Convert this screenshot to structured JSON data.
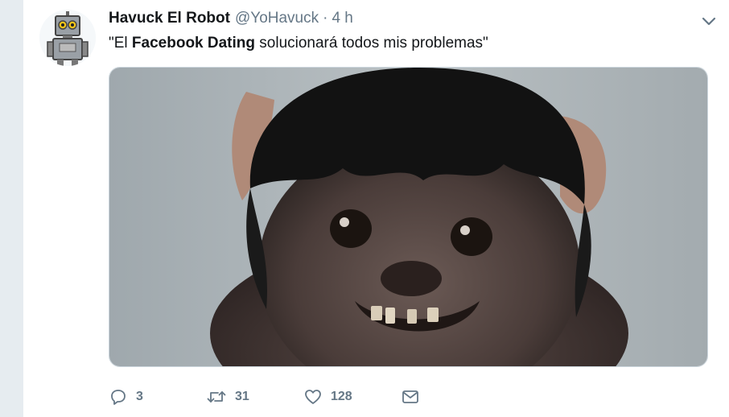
{
  "tweet": {
    "author_name": "Havuck El Robot",
    "author_handle": "@YoHavuck",
    "separator": "·",
    "time_ago": "4 h",
    "text_before": "\"El ",
    "text_bold": "Facebook Dating",
    "text_after": " solucionará todos mis problemas\"",
    "media_description": "meme photo of a hairy creature wearing a black wig, smiling"
  },
  "actions": {
    "replies": "3",
    "retweets": "31",
    "likes": "128"
  },
  "icons": {
    "menu": "chevron-down-icon",
    "reply": "reply-icon",
    "retweet": "retweet-icon",
    "like": "heart-icon",
    "message": "envelope-icon"
  },
  "colors": {
    "background": "#e6ecf0",
    "text": "#14171a",
    "secondary": "#657786",
    "border": "#ccd6dd"
  }
}
